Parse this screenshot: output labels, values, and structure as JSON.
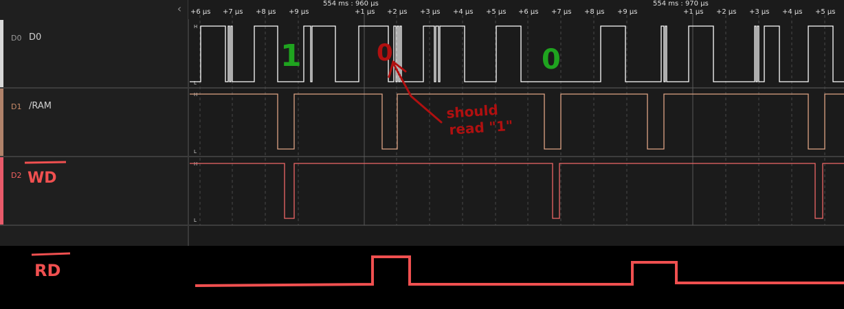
{
  "timeline": {
    "major_labels": [
      "554 ms : 960 µs",
      "554 ms : 970 µs"
    ],
    "ticks": [
      "+6 µs",
      "+7 µs",
      "+8 µs",
      "+9 µs",
      "+1 µs",
      "+2 µs",
      "+3 µs",
      "+4 µs",
      "+5 µs",
      "+6 µs",
      "+7 µs",
      "+8 µs",
      "+9 µs",
      "+1 µs",
      "+2 µs",
      "+3 µs",
      "+4 µs",
      "+5 µs"
    ]
  },
  "channels": [
    {
      "id": "D0",
      "name": "D0",
      "color": "#d8d8d8"
    },
    {
      "id": "D1",
      "name": "/RAM",
      "color": "#c98c6a"
    },
    {
      "id": "D2",
      "name": "",
      "color": "#f06060"
    }
  ],
  "level_labels": {
    "high": "H",
    "low": "L"
  },
  "annotations": {
    "bit1": "1",
    "bit0_wrong": "0",
    "bit0_right": "0",
    "note_line1": "should",
    "note_line2": "read \"1\"",
    "wd_label": "WD",
    "rd_label": "RD"
  },
  "colors": {
    "background": "#1b1b1b",
    "d0_trace": "#ffffff",
    "d1_trace": "#e0a585",
    "d2_trace": "#f06868",
    "annotation_green": "#1fa31f",
    "annotation_red": "#b01010",
    "rd_trace": "#f05050",
    "rd_label": "#f05050"
  },
  "icons": {
    "collapse": "chevron-left-icon"
  }
}
